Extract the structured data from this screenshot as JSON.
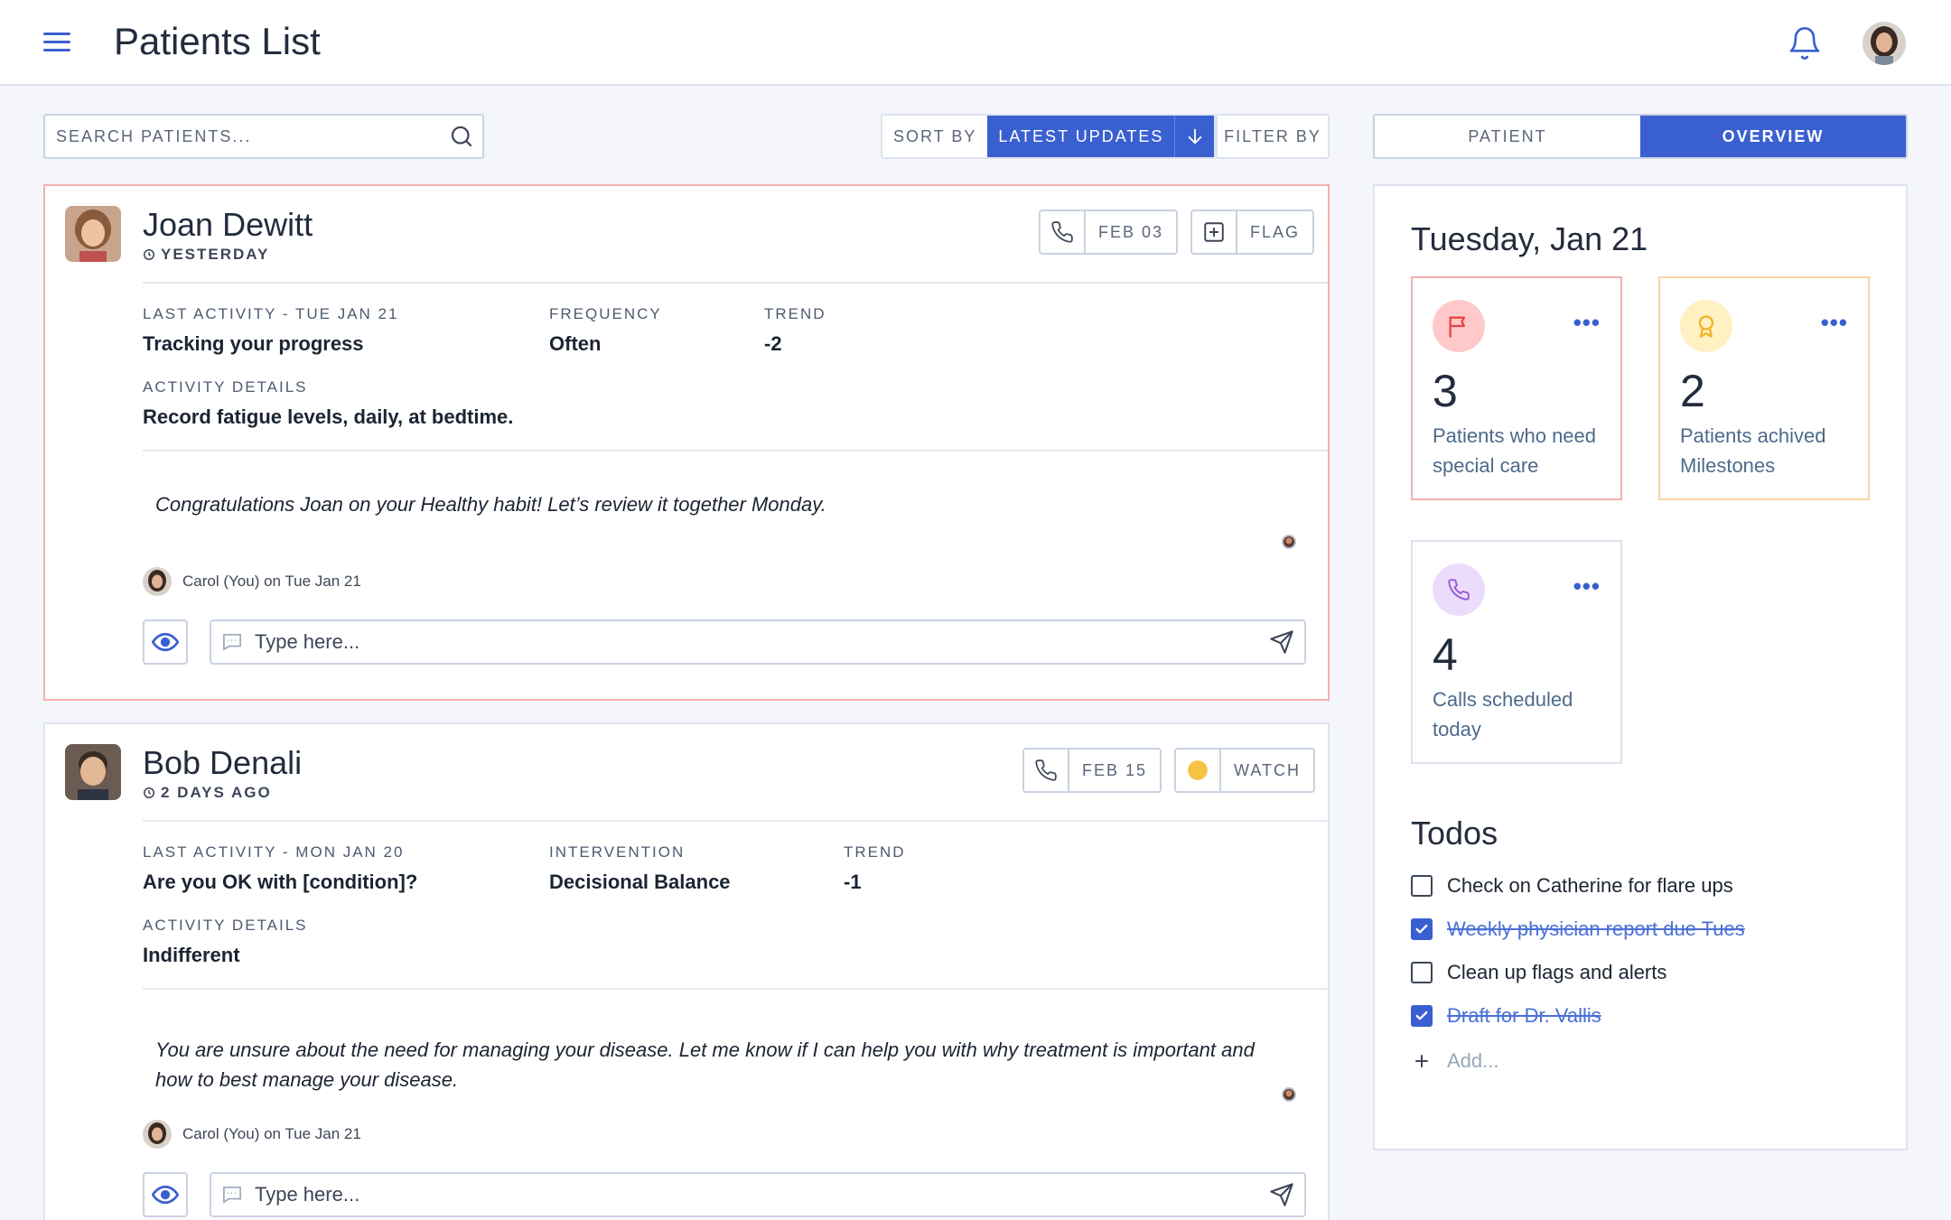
{
  "header": {
    "title": "Patients List"
  },
  "toolbar": {
    "search_placeholder": "SEARCH PATIENTS...",
    "sort_label": "SORT BY",
    "sort_value": "LATEST UPDATES",
    "filter_label": "FILTER BY"
  },
  "tabs": [
    {
      "label": "PATIENT",
      "active": false
    },
    {
      "label": "OVERVIEW",
      "active": true
    }
  ],
  "patients": [
    {
      "name": "Joan Dewitt",
      "time": "YESTERDAY",
      "status": "alert",
      "call_date": "FEB 03",
      "action_label": "FLAG",
      "action_icon": "flag-plus-icon",
      "fields": [
        {
          "label": "LAST ACTIVITY - TUE JAN 21",
          "value": "Tracking your progress"
        },
        {
          "label": "FREQUENCY",
          "value": "Often"
        },
        {
          "label": "TREND",
          "value": "-2"
        }
      ],
      "details_label": "ACTIVITY DETAILS",
      "details_value": "Record fatigue levels, daily, at bedtime.",
      "message": "Congratulations Joan on your Healthy habit! Let’s review it together Monday.",
      "author": "Carol (You) on Tue Jan 21",
      "reply_placeholder": "Type here..."
    },
    {
      "name": "Bob Denali",
      "time": "2 DAYS AGO",
      "status": "watch",
      "call_date": "FEB 15",
      "action_label": "WATCH",
      "action_icon": "yellow-dot-icon",
      "fields": [
        {
          "label": "LAST ACTIVITY - MON JAN 20",
          "value": "Are you OK with [condition]?"
        },
        {
          "label": "INTERVENTION",
          "value": "Decisional Balance"
        },
        {
          "label": "TREND",
          "value": "-1"
        }
      ],
      "details_label": "ACTIVITY DETAILS",
      "details_value": "Indifferent",
      "message": "You are unsure about the need for managing your disease. Let me know if I can help you with why treatment is important and how to best manage your disease.",
      "author": "Carol (You) on Tue Jan 21",
      "reply_placeholder": "Type here..."
    }
  ],
  "overview": {
    "date": "Tuesday, Jan 21",
    "stats": [
      {
        "count": "3",
        "label": "Patients who need special care",
        "icon": "flag-icon",
        "color": "#e84545"
      },
      {
        "count": "2",
        "label": "Patients achived Milestones",
        "icon": "award-icon",
        "color": "#f0b429"
      },
      {
        "count": "4",
        "label": "Calls scheduled today",
        "icon": "phone-icon",
        "color": "#9b59d6"
      }
    ],
    "more_label": "•••",
    "todos_title": "Todos",
    "todos": [
      {
        "text": "Check on Catherine for flare ups",
        "done": false
      },
      {
        "text": "Weekly physician report due Tues",
        "done": true
      },
      {
        "text": "Clean up flags and alerts",
        "done": false
      },
      {
        "text": "Draft for Dr. Vallis",
        "done": true
      }
    ],
    "add_label": "Add..."
  },
  "colors": {
    "accent": "#3a5fd0",
    "alert_border": "#f3b0b0",
    "watch": "#f5c242"
  }
}
